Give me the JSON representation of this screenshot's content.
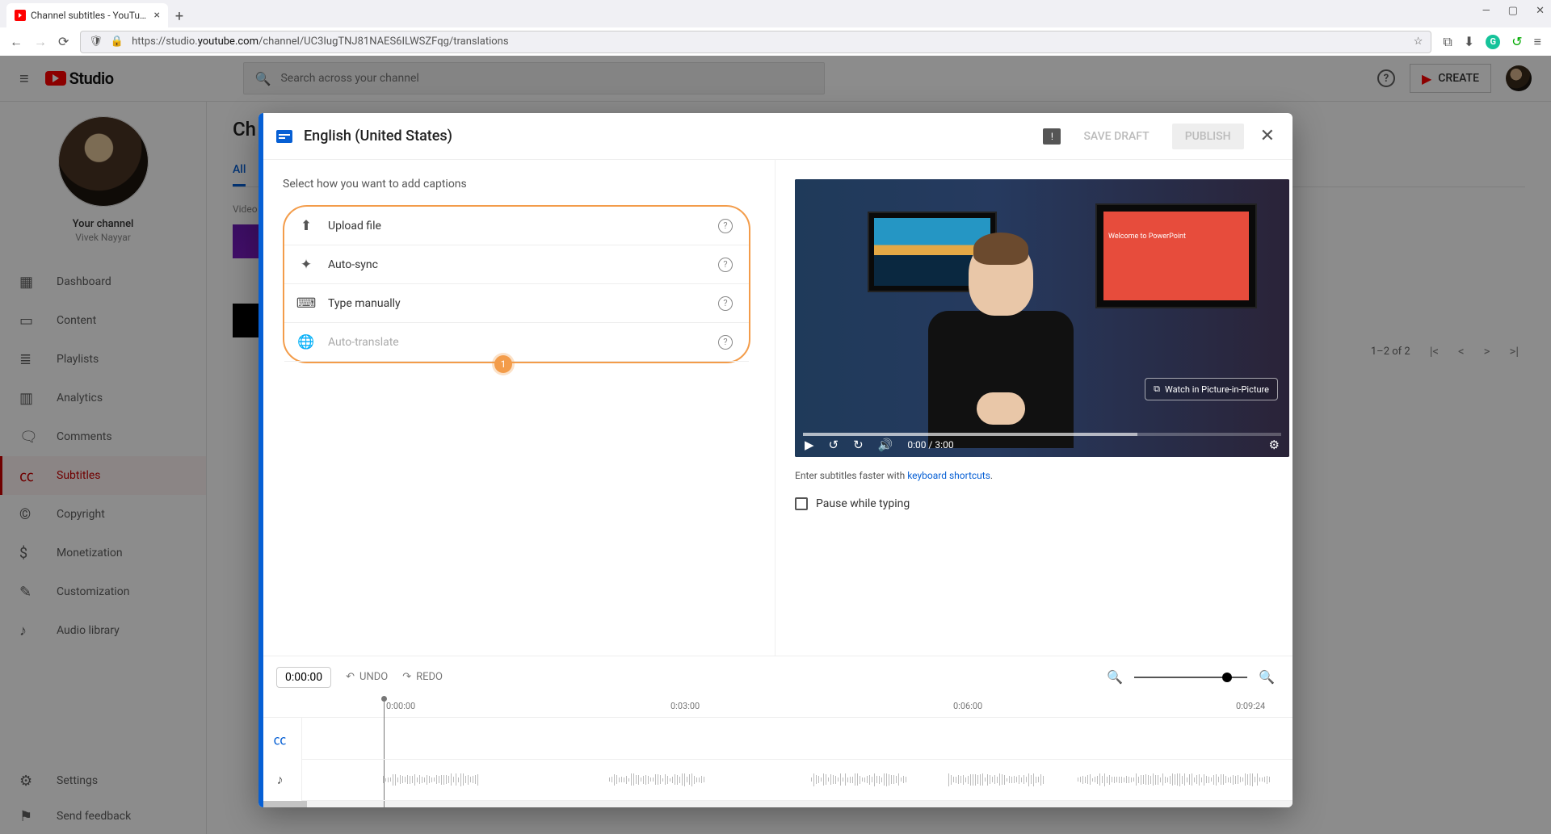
{
  "browser": {
    "tab_title": "Channel subtitles - YouTube Stu",
    "url_prefix": "https://studio.",
    "url_domain": "youtube.com",
    "url_path": "/channel/UC3IugTNJ81NAES6ILWSZFqg/translations"
  },
  "header": {
    "logo_text": "Studio",
    "search_placeholder": "Search across your channel",
    "create_label": "CREATE"
  },
  "sidebar": {
    "channel_title": "Your channel",
    "channel_subtitle": "Vivek Nayyar",
    "items": [
      {
        "icon": "dashboard-icon",
        "glyph": "▦",
        "label": "Dashboard"
      },
      {
        "icon": "content-icon",
        "glyph": "▭",
        "label": "Content"
      },
      {
        "icon": "playlists-icon",
        "glyph": "≣",
        "label": "Playlists"
      },
      {
        "icon": "analytics-icon",
        "glyph": "▥",
        "label": "Analytics"
      },
      {
        "icon": "comments-icon",
        "glyph": "🗨",
        "label": "Comments"
      },
      {
        "icon": "subtitles-icon",
        "glyph": "㏄",
        "label": "Subtitles"
      },
      {
        "icon": "copyright-icon",
        "glyph": "©",
        "label": "Copyright"
      },
      {
        "icon": "monetization-icon",
        "glyph": "$",
        "label": "Monetization"
      },
      {
        "icon": "customization-icon",
        "glyph": "✎",
        "label": "Customization"
      },
      {
        "icon": "audio-library-icon",
        "glyph": "♪",
        "label": "Audio library"
      }
    ],
    "bottom": [
      {
        "icon": "settings-icon",
        "glyph": "⚙",
        "label": "Settings"
      },
      {
        "icon": "feedback-icon",
        "glyph": "⚑",
        "label": "Send feedback"
      }
    ]
  },
  "page": {
    "title_fragment": "Ch",
    "tab_label_fragment": "All",
    "col_header": "Video",
    "pagination_text": "1–2 of 2"
  },
  "dialog": {
    "title": "English (United States)",
    "save_draft": "SAVE DRAFT",
    "publish": "PUBLISH",
    "instruction": "Select how you want to add captions",
    "options": [
      {
        "icon": "upload-icon",
        "glyph": "⬆",
        "label": "Upload file",
        "disabled": false
      },
      {
        "icon": "auto-sync-icon",
        "glyph": "✦",
        "label": "Auto-sync",
        "disabled": false
      },
      {
        "icon": "keyboard-icon",
        "glyph": "⌨",
        "label": "Type manually",
        "disabled": false
      },
      {
        "icon": "translate-icon",
        "glyph": "🌐",
        "label": "Auto-translate",
        "disabled": true
      }
    ],
    "callout": "1",
    "slide_text": "Welcome to PowerPoint",
    "pip_label": "Watch in Picture-in-Picture",
    "player_time": "0:00 / 3:00",
    "hint_prefix": "Enter subtitles faster with ",
    "hint_link": "keyboard shortcuts",
    "hint_suffix": ".",
    "pause_label": "Pause while typing",
    "timeline": {
      "time_chip": "0:00:00",
      "undo": "UNDO",
      "redo": "REDO",
      "ruler": [
        "0:00:00",
        "0:03:00",
        "0:06:00",
        "0:09:24"
      ]
    }
  }
}
